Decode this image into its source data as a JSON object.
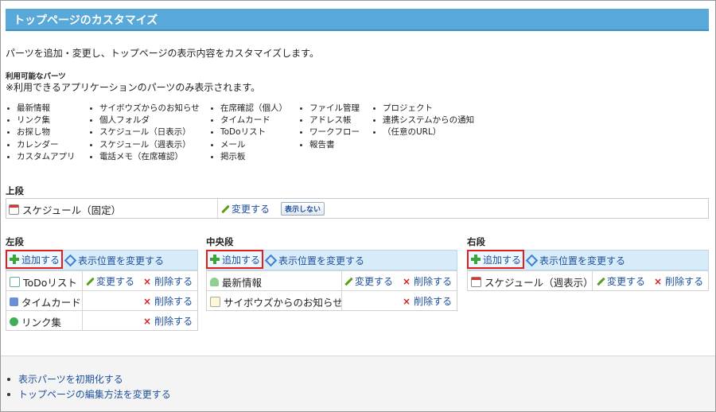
{
  "title": "トップページのカスタマイズ",
  "description": "パーツを追加・変更し、トップページの表示内容をカスタマイズします。",
  "available": {
    "heading": "利用可能なパーツ",
    "note": "※利用できるアプリケーションのパーツのみ表示されます。",
    "columns": [
      [
        "最新情報",
        "リンク集",
        "お探し物",
        "カレンダー",
        "カスタムアプリ"
      ],
      [
        "サイボウズからのお知らせ",
        "個人フォルダ",
        "スケジュール（日表示）",
        "スケジュール（週表示）",
        "電話メモ（在席確認）"
      ],
      [
        "在席確認（個人）",
        "タイムカード",
        "ToDoリスト",
        "メール",
        "掲示板"
      ],
      [
        "ファイル管理",
        "アドレス帳",
        "ワークフロー",
        "報告書"
      ],
      [
        "プロジェクト",
        "連携システムからの通知",
        "（任意のURL）"
      ]
    ]
  },
  "actions": {
    "add": "追加する",
    "move": "表示位置を変更する",
    "change": "変更する",
    "delete": "削除する",
    "hide": "表示しない"
  },
  "top_section": {
    "label": "上段",
    "part": "スケジュール（固定）"
  },
  "left_section": {
    "label": "左段",
    "parts": [
      "ToDoリスト",
      "タイムカード",
      "リンク集"
    ]
  },
  "center_section": {
    "label": "中央段",
    "parts": [
      "最新情報",
      "サイボウズからのお知らせ"
    ]
  },
  "right_section": {
    "label": "右段",
    "parts": [
      "スケジュール（週表示）"
    ]
  },
  "footer": {
    "reset": "表示パーツを初期化する",
    "edit_method": "トップページの編集方法を変更する"
  },
  "colors": {
    "title_bar": "#58a9d9",
    "toolbar_bg": "#d8ebf8",
    "highlight_border": "#e01e1e",
    "link": "#1b4f9c"
  }
}
